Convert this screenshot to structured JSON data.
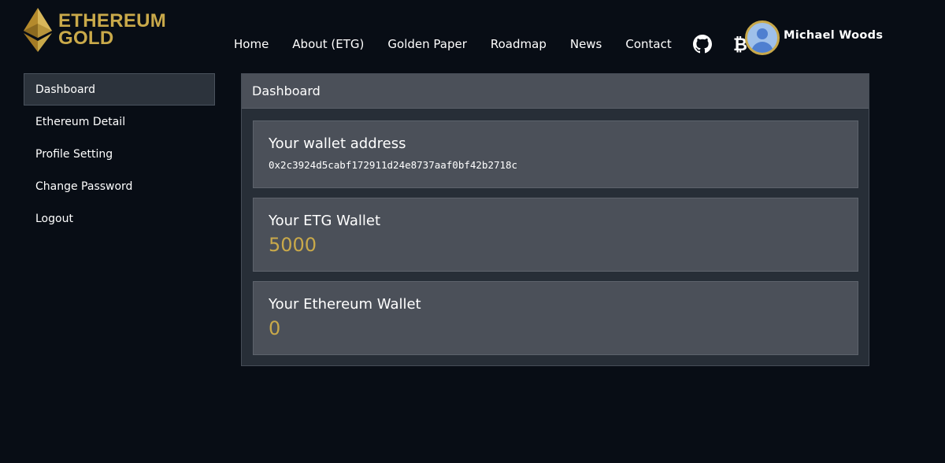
{
  "brand": {
    "line1": "ETHEREUM",
    "line2": "GOLD",
    "color": "#c9a94a"
  },
  "nav": {
    "items": [
      "Home",
      "About (ETG)",
      "Golden Paper",
      "Roadmap",
      "News",
      "Contact"
    ],
    "icons": [
      "github-icon",
      "bitcoin-icon"
    ]
  },
  "user": {
    "name": "Michael Woods",
    "avatar_icon": "user-avatar-icon"
  },
  "sidebar": {
    "items": [
      {
        "label": "Dashboard",
        "active": true
      },
      {
        "label": "Ethereum Detail",
        "active": false
      },
      {
        "label": "Profile Setting",
        "active": false
      },
      {
        "label": "Change Password",
        "active": false
      },
      {
        "label": "Logout",
        "active": false
      }
    ]
  },
  "panel": {
    "title": "Dashboard",
    "wallet_address": {
      "label": "Your wallet address",
      "value": "0x2c3924d5cabf172911d24e8737aaf0bf42b2718c"
    },
    "etg_wallet": {
      "label": "Your ETG Wallet",
      "value": "5000"
    },
    "eth_wallet": {
      "label": "Your Ethereum Wallet",
      "value": "0"
    }
  },
  "colors": {
    "background": "#080d15",
    "accent": "#c9a94a",
    "card": "#4b5059"
  }
}
